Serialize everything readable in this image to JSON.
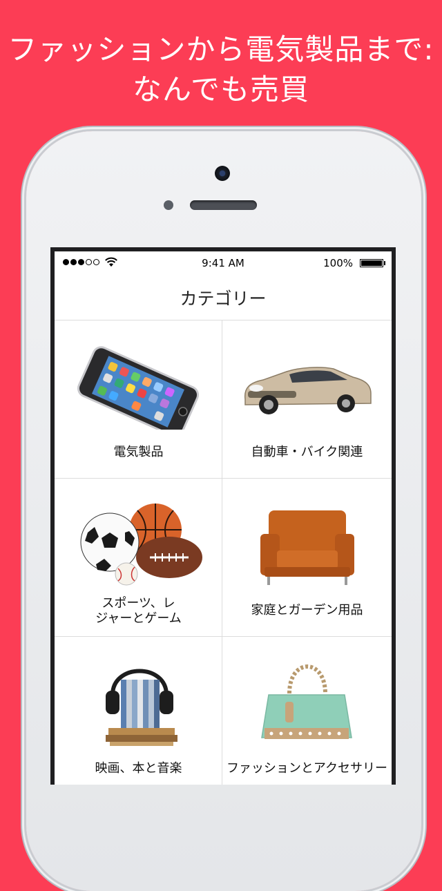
{
  "promo": {
    "line1": "ファッションから電気製品まで:",
    "line2": "なんでも売買"
  },
  "status_bar": {
    "time": "9:41 AM",
    "battery": "100%"
  },
  "nav": {
    "title": "カテゴリー"
  },
  "categories": [
    {
      "label": "電気製品",
      "icon": "smartphone-image"
    },
    {
      "label": "自動車・バイク関連",
      "icon": "car-image"
    },
    {
      "label_line1": "スポーツ、レ",
      "label_line2": "ジャーとゲーム",
      "icon": "sports-balls-image"
    },
    {
      "label": "家庭とガーデン用品",
      "icon": "armchair-image"
    },
    {
      "label": "映画、本と音楽",
      "icon": "media-headphones-image"
    },
    {
      "label": "ファッションとアクセサリー",
      "icon": "handbag-image"
    }
  ],
  "colors": {
    "background": "#fc3d55",
    "divider": "#dcdcdc"
  }
}
